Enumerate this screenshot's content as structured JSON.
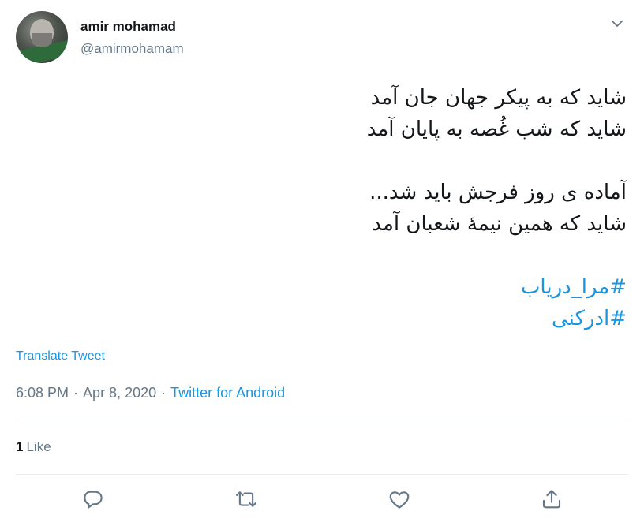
{
  "author": {
    "name": "amir mohamad",
    "handle": "@amirmohamam",
    "avatar": "profile-photo"
  },
  "tweet": {
    "lines": [
      "شاید که به پیکر جهان جان آمد",
      "شاید که شب غُصه به پایان آمد",
      "آماده ی روز فرجش  باید شد...",
      "شاید که همین نیمهٔ شعبان آمد"
    ],
    "hashtags": [
      "#مرا_درياب",
      "#ادرکنی"
    ]
  },
  "translate_label": "Translate Tweet",
  "meta": {
    "time": "6:08 PM",
    "separator": "·",
    "date": "Apr 8, 2020",
    "source": "Twitter for Android"
  },
  "stats": {
    "likes_count": "1",
    "likes_label": "Like"
  },
  "icons": {
    "menu": "chevron-down-icon",
    "reply": "reply-icon",
    "retweet": "retweet-icon",
    "like": "heart-icon",
    "share": "share-icon"
  },
  "colors": {
    "link": "#1b95e0",
    "secondary_text": "#657786",
    "primary_text": "#14171a",
    "divider": "#e6ecf0",
    "icon": "#657786"
  }
}
